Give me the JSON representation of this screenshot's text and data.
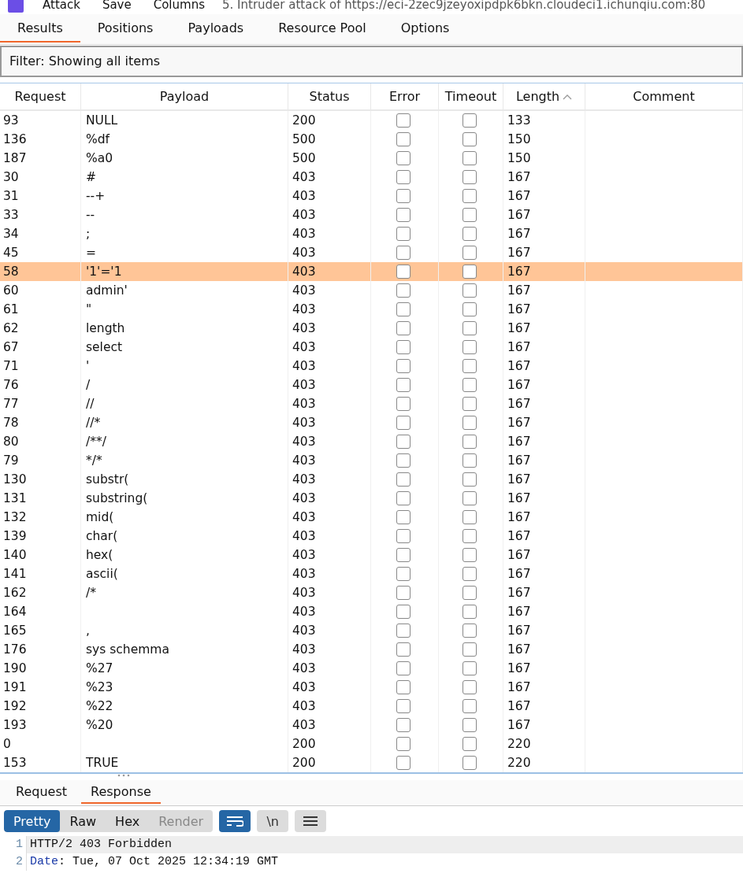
{
  "menu": [
    "Attack",
    "Save",
    "Columns"
  ],
  "window": {
    "title": "5. Intruder attack of https://eci-2zec9jzeyoxipdpk6bkn.cloudeci1.ichunqiu.com:80"
  },
  "tabs": [
    {
      "label": "Results",
      "selected": true
    },
    {
      "label": "Positions",
      "selected": false
    },
    {
      "label": "Payloads",
      "selected": false
    },
    {
      "label": "Resource Pool",
      "selected": false
    },
    {
      "label": "Options",
      "selected": false
    }
  ],
  "filter": {
    "value": "Filter: Showing all items"
  },
  "table": {
    "columns": [
      {
        "label": "Request",
        "sorted": false
      },
      {
        "label": "Payload",
        "sorted": false
      },
      {
        "label": "Status",
        "sorted": false
      },
      {
        "label": "Error",
        "sorted": false
      },
      {
        "label": "Timeout",
        "sorted": false
      },
      {
        "label": "Length",
        "sorted": true
      },
      {
        "label": "Comment",
        "sorted": false
      }
    ],
    "rows": [
      {
        "request": "93",
        "payload": "NULL",
        "status": "200",
        "error": false,
        "timeout": false,
        "length": "133",
        "selected": false
      },
      {
        "request": "136",
        "payload": "%df",
        "status": "500",
        "error": false,
        "timeout": false,
        "length": "150",
        "selected": false
      },
      {
        "request": "187",
        "payload": "%a0",
        "status": "500",
        "error": false,
        "timeout": false,
        "length": "150",
        "selected": false
      },
      {
        "request": "30",
        "payload": "#",
        "status": "403",
        "error": false,
        "timeout": false,
        "length": "167",
        "selected": false
      },
      {
        "request": "31",
        "payload": "--+",
        "status": "403",
        "error": false,
        "timeout": false,
        "length": "167",
        "selected": false
      },
      {
        "request": "33",
        "payload": "--",
        "status": "403",
        "error": false,
        "timeout": false,
        "length": "167",
        "selected": false
      },
      {
        "request": "34",
        "payload": ";",
        "status": "403",
        "error": false,
        "timeout": false,
        "length": "167",
        "selected": false
      },
      {
        "request": "45",
        "payload": "=",
        "status": "403",
        "error": false,
        "timeout": false,
        "length": "167",
        "selected": false
      },
      {
        "request": "58",
        "payload": "'1'='1",
        "status": "403",
        "error": false,
        "timeout": false,
        "length": "167",
        "selected": true
      },
      {
        "request": "60",
        "payload": "admin'",
        "status": "403",
        "error": false,
        "timeout": false,
        "length": "167",
        "selected": false
      },
      {
        "request": "61",
        "payload": "\"",
        "status": "403",
        "error": false,
        "timeout": false,
        "length": "167",
        "selected": false
      },
      {
        "request": "62",
        "payload": "length",
        "status": "403",
        "error": false,
        "timeout": false,
        "length": "167",
        "selected": false
      },
      {
        "request": "67",
        "payload": "select",
        "status": "403",
        "error": false,
        "timeout": false,
        "length": "167",
        "selected": false
      },
      {
        "request": "71",
        "payload": "'",
        "status": "403",
        "error": false,
        "timeout": false,
        "length": "167",
        "selected": false
      },
      {
        "request": "76",
        "payload": "/",
        "status": "403",
        "error": false,
        "timeout": false,
        "length": "167",
        "selected": false
      },
      {
        "request": "77",
        "payload": "//",
        "status": "403",
        "error": false,
        "timeout": false,
        "length": "167",
        "selected": false
      },
      {
        "request": "78",
        "payload": "//*",
        "status": "403",
        "error": false,
        "timeout": false,
        "length": "167",
        "selected": false
      },
      {
        "request": "80",
        "payload": "/**/",
        "status": "403",
        "error": false,
        "timeout": false,
        "length": "167",
        "selected": false
      },
      {
        "request": "79",
        "payload": "*/*",
        "status": "403",
        "error": false,
        "timeout": false,
        "length": "167",
        "selected": false
      },
      {
        "request": "130",
        "payload": "substr(",
        "status": "403",
        "error": false,
        "timeout": false,
        "length": "167",
        "selected": false
      },
      {
        "request": "131",
        "payload": "substring(",
        "status": "403",
        "error": false,
        "timeout": false,
        "length": "167",
        "selected": false
      },
      {
        "request": "132",
        "payload": "mid(",
        "status": "403",
        "error": false,
        "timeout": false,
        "length": "167",
        "selected": false
      },
      {
        "request": "139",
        "payload": "char(",
        "status": "403",
        "error": false,
        "timeout": false,
        "length": "167",
        "selected": false
      },
      {
        "request": "140",
        "payload": "hex(",
        "status": "403",
        "error": false,
        "timeout": false,
        "length": "167",
        "selected": false
      },
      {
        "request": "141",
        "payload": "ascii(",
        "status": "403",
        "error": false,
        "timeout": false,
        "length": "167",
        "selected": false
      },
      {
        "request": "162",
        "payload": "/*",
        "status": "403",
        "error": false,
        "timeout": false,
        "length": "167",
        "selected": false
      },
      {
        "request": "164",
        "status": "403",
        "error": false,
        "timeout": false,
        "length": "167",
        "selected": false
      },
      {
        "request": "165",
        "payload": ",",
        "status": "403",
        "error": false,
        "timeout": false,
        "length": "167",
        "selected": false
      },
      {
        "request": "176",
        "payload": "sys schemma",
        "status": "403",
        "error": false,
        "timeout": false,
        "length": "167",
        "selected": false
      },
      {
        "request": "190",
        "payload": "%27",
        "status": "403",
        "error": false,
        "timeout": false,
        "length": "167",
        "selected": false
      },
      {
        "request": "191",
        "payload": "%23",
        "status": "403",
        "error": false,
        "timeout": false,
        "length": "167",
        "selected": false
      },
      {
        "request": "192",
        "payload": "%22",
        "status": "403",
        "error": false,
        "timeout": false,
        "length": "167",
        "selected": false
      },
      {
        "request": "193",
        "payload": "%20",
        "status": "403",
        "error": false,
        "timeout": false,
        "length": "167",
        "selected": false
      },
      {
        "request": "0",
        "status": "200",
        "error": false,
        "timeout": false,
        "length": "220",
        "selected": false
      },
      {
        "request": "153",
        "payload": "TRUE",
        "status": "200",
        "error": false,
        "timeout": false,
        "length": "220",
        "selected": false
      }
    ]
  },
  "message_tabs": [
    {
      "label": "Request",
      "selected": false
    },
    {
      "label": "Response",
      "selected": true
    }
  ],
  "view_modes": [
    {
      "label": "Pretty",
      "selected": true,
      "disabled": false
    },
    {
      "label": "Raw",
      "selected": false,
      "disabled": false
    },
    {
      "label": "Hex",
      "selected": false,
      "disabled": false
    },
    {
      "label": "Render",
      "selected": false,
      "disabled": true
    }
  ],
  "view_toggles": [
    {
      "kind": "wrap",
      "on": true
    },
    {
      "kind": "newline",
      "label": "\\n",
      "on": false
    },
    {
      "kind": "menu",
      "on": false
    }
  ],
  "response_lines": [
    {
      "number": "1",
      "text": "HTTP/2 403 Forbidden"
    },
    {
      "number": "2",
      "name": "Date",
      "text": ": Tue, 07 Oct 2025 12:34:19 GMT"
    }
  ]
}
